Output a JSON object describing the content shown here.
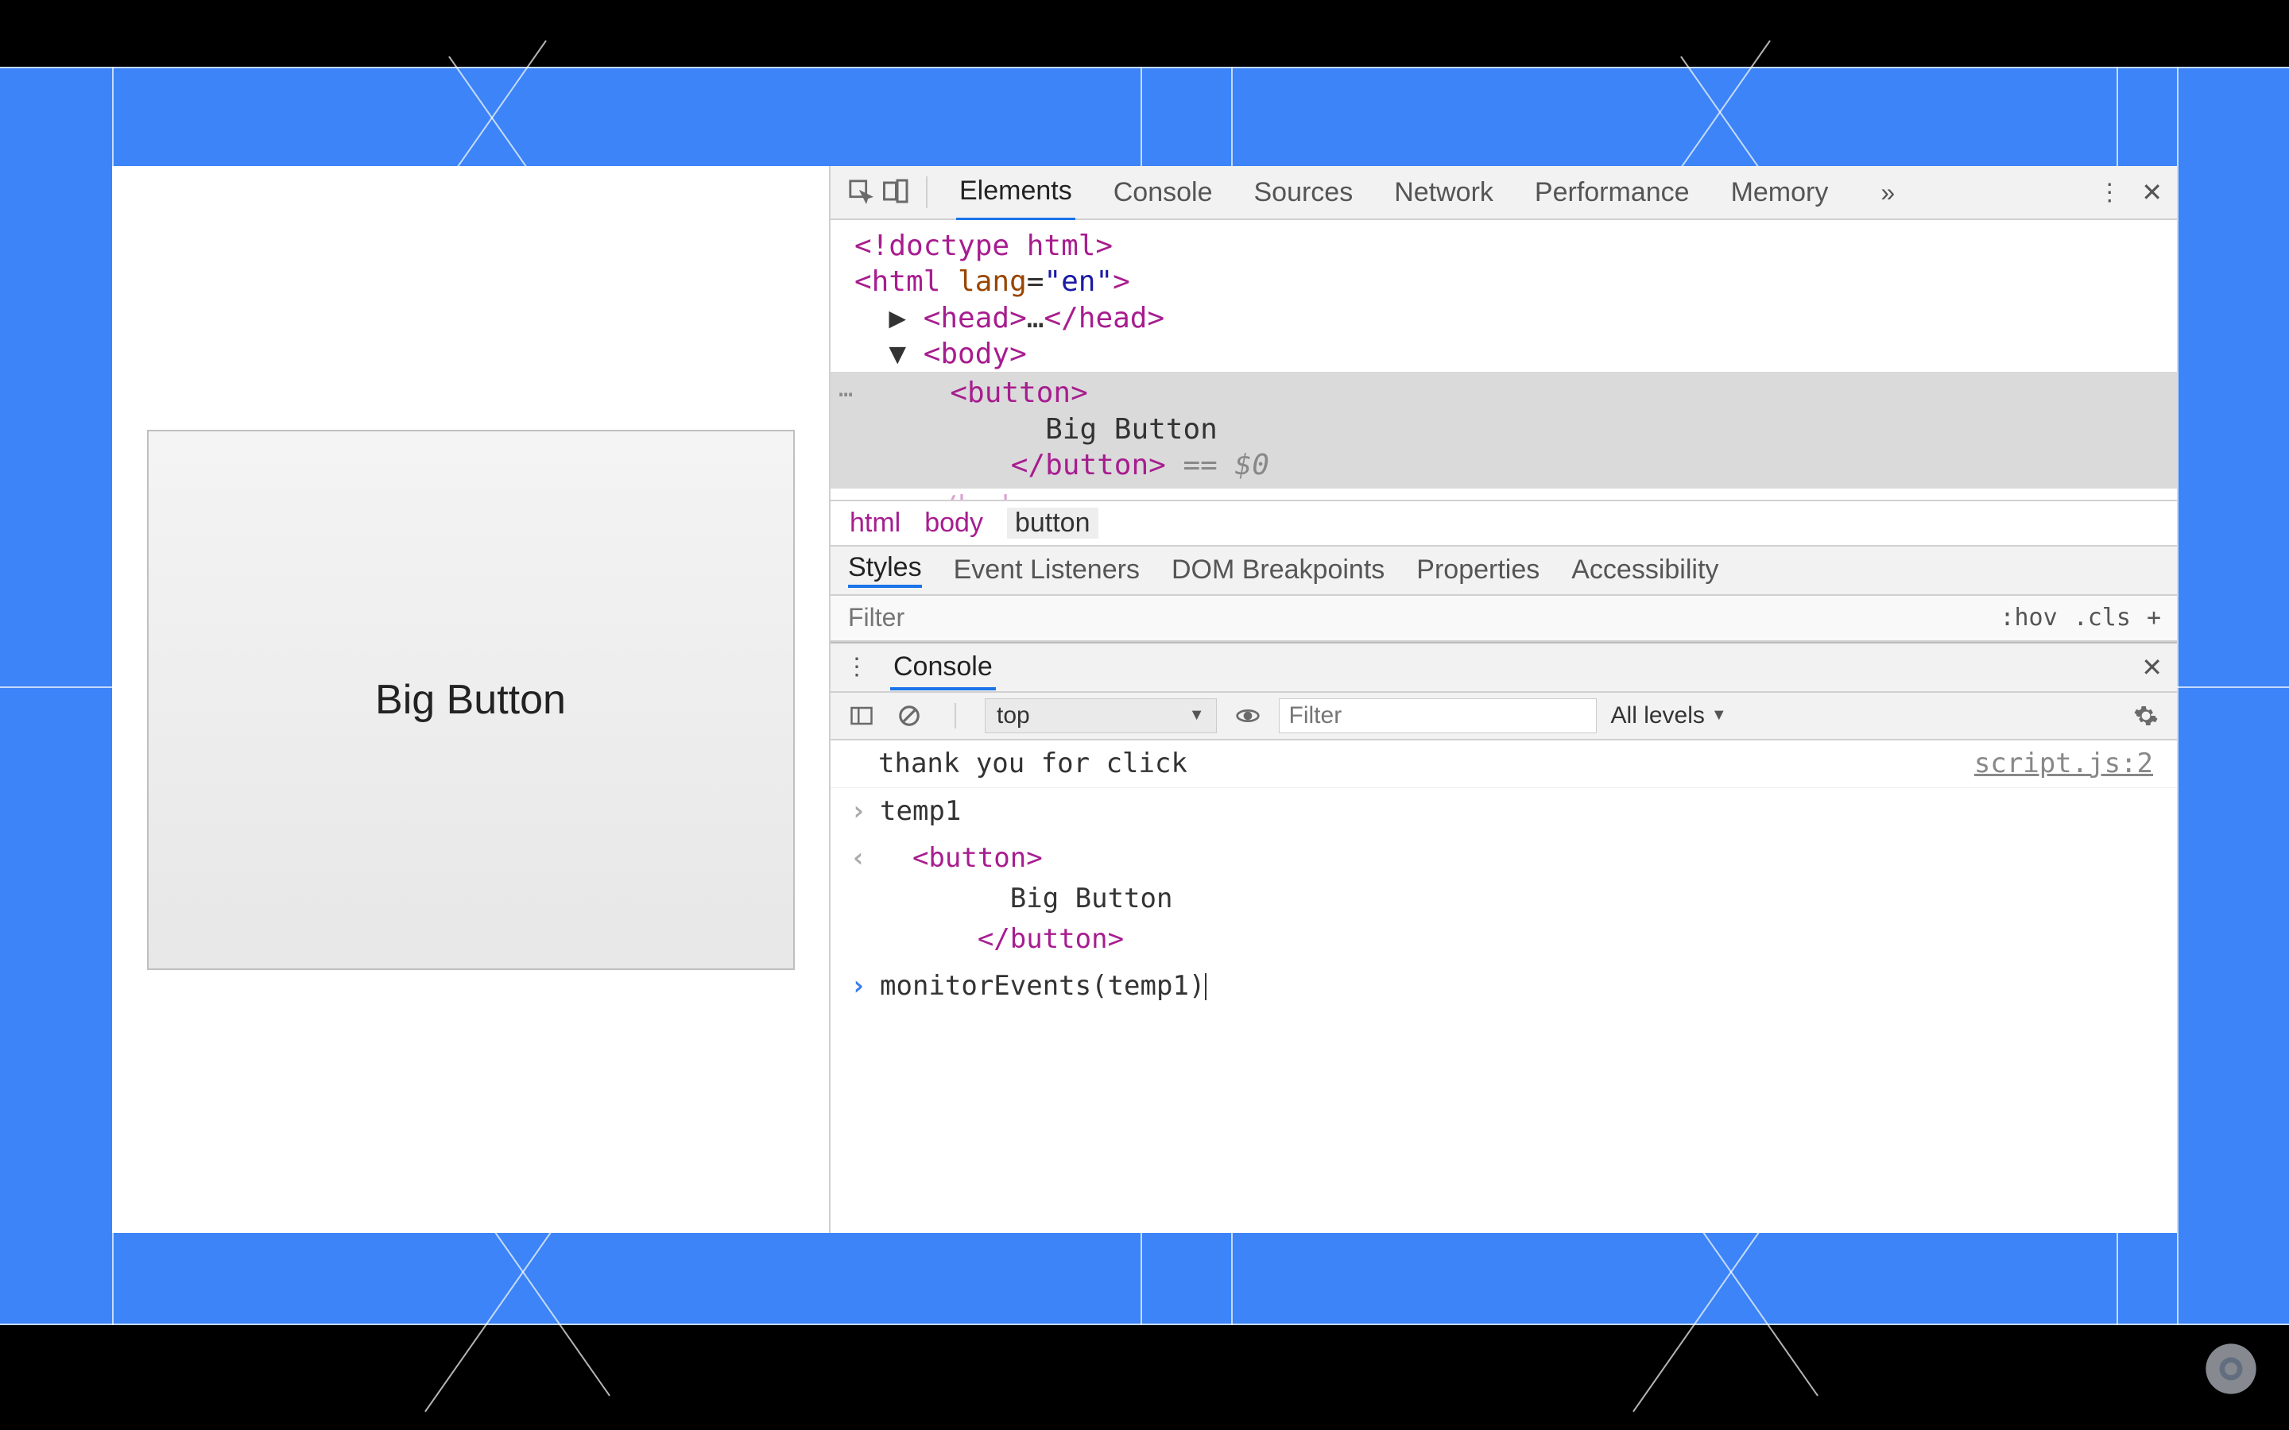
{
  "page": {
    "button_label": "Big Button"
  },
  "devtools": {
    "tabs": [
      "Elements",
      "Console",
      "Sources",
      "Network",
      "Performance",
      "Memory"
    ],
    "active_tab": "Elements"
  },
  "dom": {
    "doctype": "<!doctype html>",
    "html_open": "<html lang=\"en\">",
    "head_collapsed": "<head>…</head>",
    "body_open": "<body>",
    "button_open": "<button>",
    "button_text": "Big Button",
    "button_close": "</button>",
    "eq0": " == $0",
    "body_close": "</body>"
  },
  "breadcrumb": [
    "html",
    "body",
    "button"
  ],
  "subtabs": [
    "Styles",
    "Event Listeners",
    "DOM Breakpoints",
    "Properties",
    "Accessibility"
  ],
  "active_subtab": "Styles",
  "filter": {
    "placeholder": "Filter",
    "hov": ":hov",
    "cls": ".cls",
    "plus": "+"
  },
  "drawer": {
    "label": "Console"
  },
  "console_toolbar": {
    "context": "top",
    "filter_placeholder": "Filter",
    "levels": "All levels"
  },
  "console": {
    "log_msg": "thank you for click",
    "log_src": "script.js:2",
    "input1": "temp1",
    "out_button_open": "<button>",
    "out_button_text": "Big Button",
    "out_button_close": "</button>",
    "input2": "monitorEvents(temp1)"
  }
}
